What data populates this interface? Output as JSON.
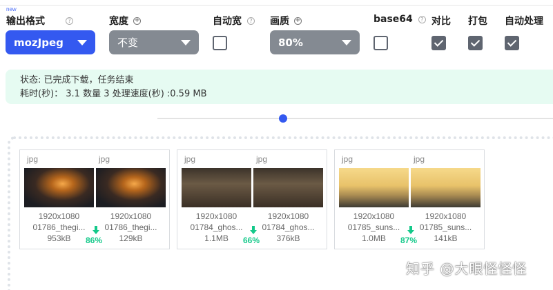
{
  "new_badge": "new",
  "controls": {
    "format": {
      "label": "输出格式",
      "value": "mozJpeg"
    },
    "width": {
      "label": "宽度",
      "value": "不变"
    },
    "auto_width": {
      "label": "自动宽"
    },
    "quality": {
      "label": "画质",
      "value": "80%"
    },
    "base64": {
      "label": "base64"
    },
    "compare": {
      "label": "对比"
    },
    "pack": {
      "label": "打包"
    },
    "auto_process": {
      "label": "自动处理"
    }
  },
  "status": {
    "line1": "状态: 已完成下载，任务结束",
    "line2": "耗时(秒)： 3.1 数量 3 处理速度(秒) :0.59 MB"
  },
  "cards": [
    {
      "left": {
        "ext": "jpg",
        "dims": "1920x1080",
        "name": "01786_thegi...",
        "size": "953kB"
      },
      "right": {
        "ext": "jpg",
        "dims": "1920x1080",
        "name": "01786_thegi...",
        "size": "129kB"
      },
      "reduction": "86%"
    },
    {
      "left": {
        "ext": "jpg",
        "dims": "1920x1080",
        "name": "01784_ghos...",
        "size": "1.1MB"
      },
      "right": {
        "ext": "jpg",
        "dims": "1920x1080",
        "name": "01784_ghos...",
        "size": "376kB"
      },
      "reduction": "66%"
    },
    {
      "left": {
        "ext": "jpg",
        "dims": "1920x1080",
        "name": "01785_suns...",
        "size": "1.0MB"
      },
      "right": {
        "ext": "jpg",
        "dims": "1920x1080",
        "name": "01785_suns...",
        "size": "141kB"
      },
      "reduction": "87%"
    }
  ],
  "watermark": "知乎 @大眼怪怪怪",
  "colors": {
    "accent": "#3459f0",
    "success": "#14c98a",
    "status_bg": "#e6fbf2"
  }
}
